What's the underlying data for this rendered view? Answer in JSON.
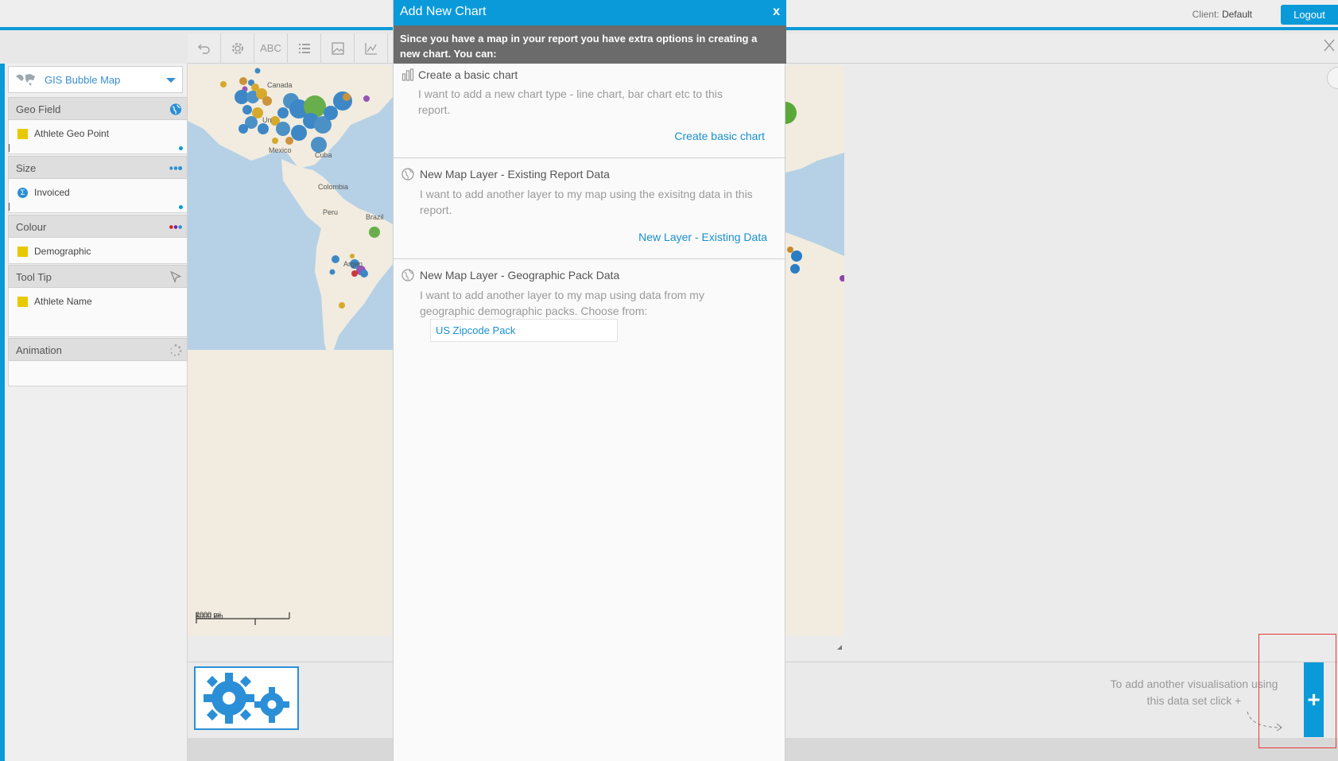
{
  "header": {
    "client_label": "Client:",
    "client_value": "Default",
    "logout_label": "Logout"
  },
  "sidebar": {
    "chart_type": "GIS Bubble Map",
    "sections": [
      {
        "title": "Geo Field",
        "field": "Athlete Geo Point"
      },
      {
        "title": "Size",
        "field": "Invoiced"
      },
      {
        "title": "Colour",
        "field": "Demographic"
      },
      {
        "title": "Tool Tip",
        "field": "Athlete Name"
      },
      {
        "title": "Animation",
        "field": ""
      }
    ]
  },
  "toolbar": {
    "text_tool": "ABC"
  },
  "map": {
    "labels": [
      "Canada",
      "Un",
      "Mexico",
      "Cuba",
      "Colombia",
      "Peru",
      "Brazil",
      "Argen"
    ],
    "scale_km": "5000 km",
    "scale_mi": "2000 mi"
  },
  "modal": {
    "title": "Add New Chart",
    "close_label": "x",
    "subtitle": "Since you have a map in your report you have extra options in creating a new chart. You can:",
    "options": [
      {
        "title": "Create a basic chart",
        "description": "I want to add a new chart type - line chart, bar chart etc to this report.",
        "link": "Create basic chart"
      },
      {
        "title": "New Map Layer - Existing Report Data",
        "description": "I want to add another layer to my map using the exisitng data in this report.",
        "link": "New Layer - Existing Data"
      },
      {
        "title": "New Map Layer - Geographic Pack Data",
        "description": "I want to add another layer to my map using data from my geographic demographic packs. Choose from:",
        "link": "US Zipcode Pack"
      }
    ]
  },
  "footer": {
    "hint": "To add another visualisation using this data set click +",
    "add_label": "+"
  },
  "colors": {
    "accent": "#0b9ad9",
    "link": "#1a8fcf",
    "field_yellow": "#e8c900",
    "map_water": "#b6d1e6"
  }
}
